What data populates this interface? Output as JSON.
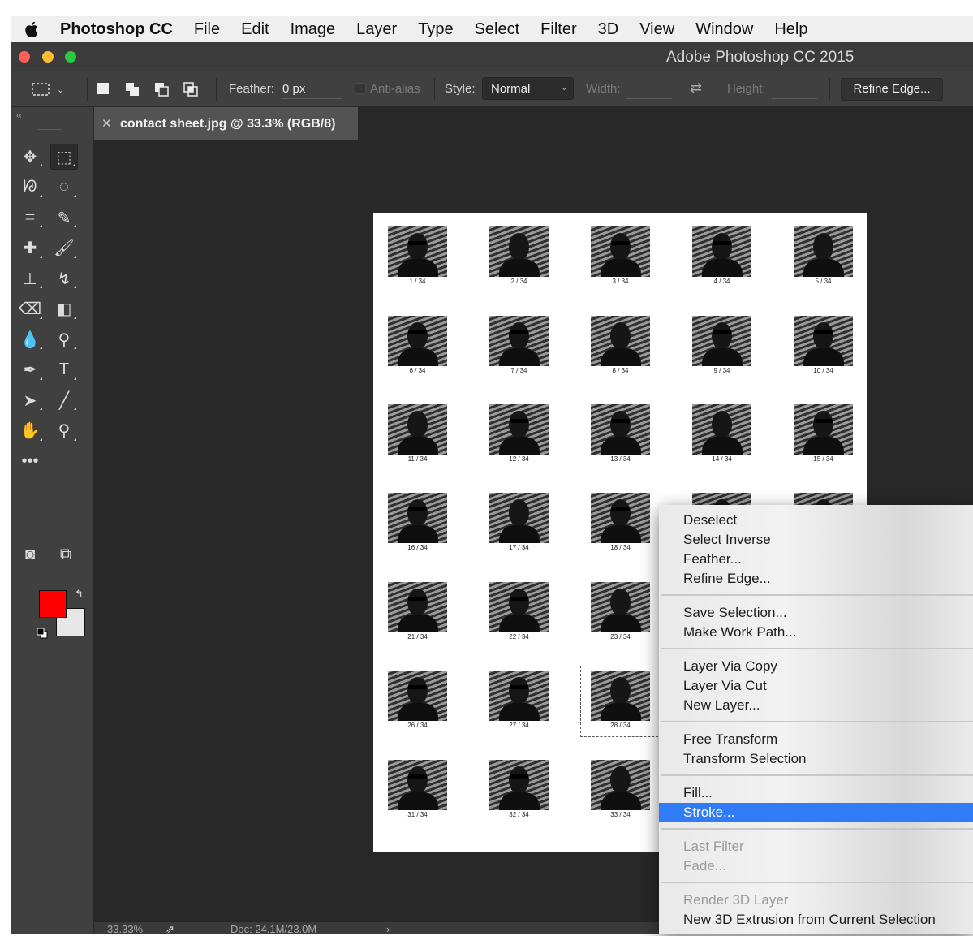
{
  "menubar": {
    "apple_icon": "apple-logo",
    "app_name": "Photoshop CC",
    "items": [
      "File",
      "Edit",
      "Image",
      "Layer",
      "Type",
      "Select",
      "Filter",
      "3D",
      "View",
      "Window",
      "Help"
    ]
  },
  "window": {
    "title": "Adobe Photoshop CC 2015",
    "traffic_lights": [
      "#fe5f57",
      "#febc2e",
      "#28c840"
    ]
  },
  "options_bar": {
    "feather_label": "Feather:",
    "feather_value": "0 px",
    "antialias_label": "Anti-alias",
    "style_label": "Style:",
    "style_value": "Normal",
    "width_label": "Width:",
    "height_label": "Height:",
    "refine_edge_label": "Refine Edge..."
  },
  "toolbar": {
    "collapse": "‹‹",
    "tools": [
      {
        "name": "move-tool-icon",
        "glyph": "✥"
      },
      {
        "name": "rectangular-marquee-tool-icon",
        "glyph": "⬚",
        "active": true
      },
      {
        "name": "lasso-tool-icon",
        "glyph": "ᘘ"
      },
      {
        "name": "quick-selection-tool-icon",
        "glyph": "◌"
      },
      {
        "name": "crop-tool-icon",
        "glyph": "⌗"
      },
      {
        "name": "eyedropper-tool-icon",
        "glyph": "✎"
      },
      {
        "name": "healing-brush-tool-icon",
        "glyph": "✚"
      },
      {
        "name": "brush-tool-icon",
        "glyph": "🖌"
      },
      {
        "name": "clone-stamp-tool-icon",
        "glyph": "⊥"
      },
      {
        "name": "history-brush-tool-icon",
        "glyph": "↯"
      },
      {
        "name": "eraser-tool-icon",
        "glyph": "⌫"
      },
      {
        "name": "gradient-tool-icon",
        "glyph": "◧"
      },
      {
        "name": "blur-tool-icon",
        "glyph": "💧"
      },
      {
        "name": "dodge-tool-icon",
        "glyph": "⚲"
      },
      {
        "name": "pen-tool-icon",
        "glyph": "✒"
      },
      {
        "name": "type-tool-icon",
        "glyph": "T"
      },
      {
        "name": "path-selection-tool-icon",
        "glyph": "➤"
      },
      {
        "name": "line-tool-icon",
        "glyph": "╱"
      },
      {
        "name": "hand-tool-icon",
        "glyph": "✋"
      },
      {
        "name": "zoom-tool-icon",
        "glyph": "⚲"
      },
      {
        "name": "more-tools-icon",
        "glyph": "•••"
      },
      {
        "name": "quick-mask-icon",
        "glyph": "◙"
      },
      {
        "name": "screen-mode-icon",
        "glyph": "⧉"
      }
    ],
    "foreground_color": "#ff0000",
    "background_color": "#e7e7e7"
  },
  "document": {
    "tab_title": "contact sheet.jpg @ 33.3% (RGB/8)",
    "thumbnails": [
      {
        "caption": "1 / 34"
      },
      {
        "caption": "2 / 34"
      },
      {
        "caption": "3 / 34"
      },
      {
        "caption": "4 / 34"
      },
      {
        "caption": "5 / 34"
      },
      {
        "caption": "6 / 34"
      },
      {
        "caption": "7 / 34"
      },
      {
        "caption": "8 / 34"
      },
      {
        "caption": "9 / 34"
      },
      {
        "caption": "10 / 34"
      },
      {
        "caption": "11 / 34"
      },
      {
        "caption": "12 / 34"
      },
      {
        "caption": "13 / 34"
      },
      {
        "caption": "14 / 34"
      },
      {
        "caption": "15 / 34"
      },
      {
        "caption": "16 / 34"
      },
      {
        "caption": "17 / 34"
      },
      {
        "caption": "18 / 34"
      },
      {
        "caption": ""
      },
      {
        "caption": ""
      },
      {
        "caption": "21 / 34"
      },
      {
        "caption": "22 / 34"
      },
      {
        "caption": "23 / 34"
      },
      {
        "caption": "26 / 34"
      },
      {
        "caption": "27 / 34"
      },
      {
        "caption": "28 / 34"
      },
      {
        "caption": "31 / 34"
      },
      {
        "caption": "32 / 34"
      },
      {
        "caption": "33 / 34"
      }
    ]
  },
  "status_bar": {
    "zoom": "33.33%",
    "doc_size": "Doc: 24.1M/23.0M",
    "arrow": "›"
  },
  "context_menu": {
    "groups": [
      [
        {
          "label": "Deselect"
        },
        {
          "label": "Select Inverse"
        },
        {
          "label": "Feather..."
        },
        {
          "label": "Refine Edge..."
        }
      ],
      [
        {
          "label": "Save Selection..."
        },
        {
          "label": "Make Work Path..."
        }
      ],
      [
        {
          "label": "Layer Via Copy"
        },
        {
          "label": "Layer Via Cut"
        },
        {
          "label": "New Layer..."
        }
      ],
      [
        {
          "label": "Free Transform"
        },
        {
          "label": "Transform Selection"
        }
      ],
      [
        {
          "label": "Fill..."
        },
        {
          "label": "Stroke...",
          "highlighted": true
        }
      ],
      [
        {
          "label": "Last Filter",
          "disabled": true
        },
        {
          "label": "Fade...",
          "disabled": true
        }
      ],
      [
        {
          "label": "Render 3D Layer",
          "disabled": true
        },
        {
          "label": "New 3D Extrusion from Current Selection"
        }
      ]
    ]
  }
}
